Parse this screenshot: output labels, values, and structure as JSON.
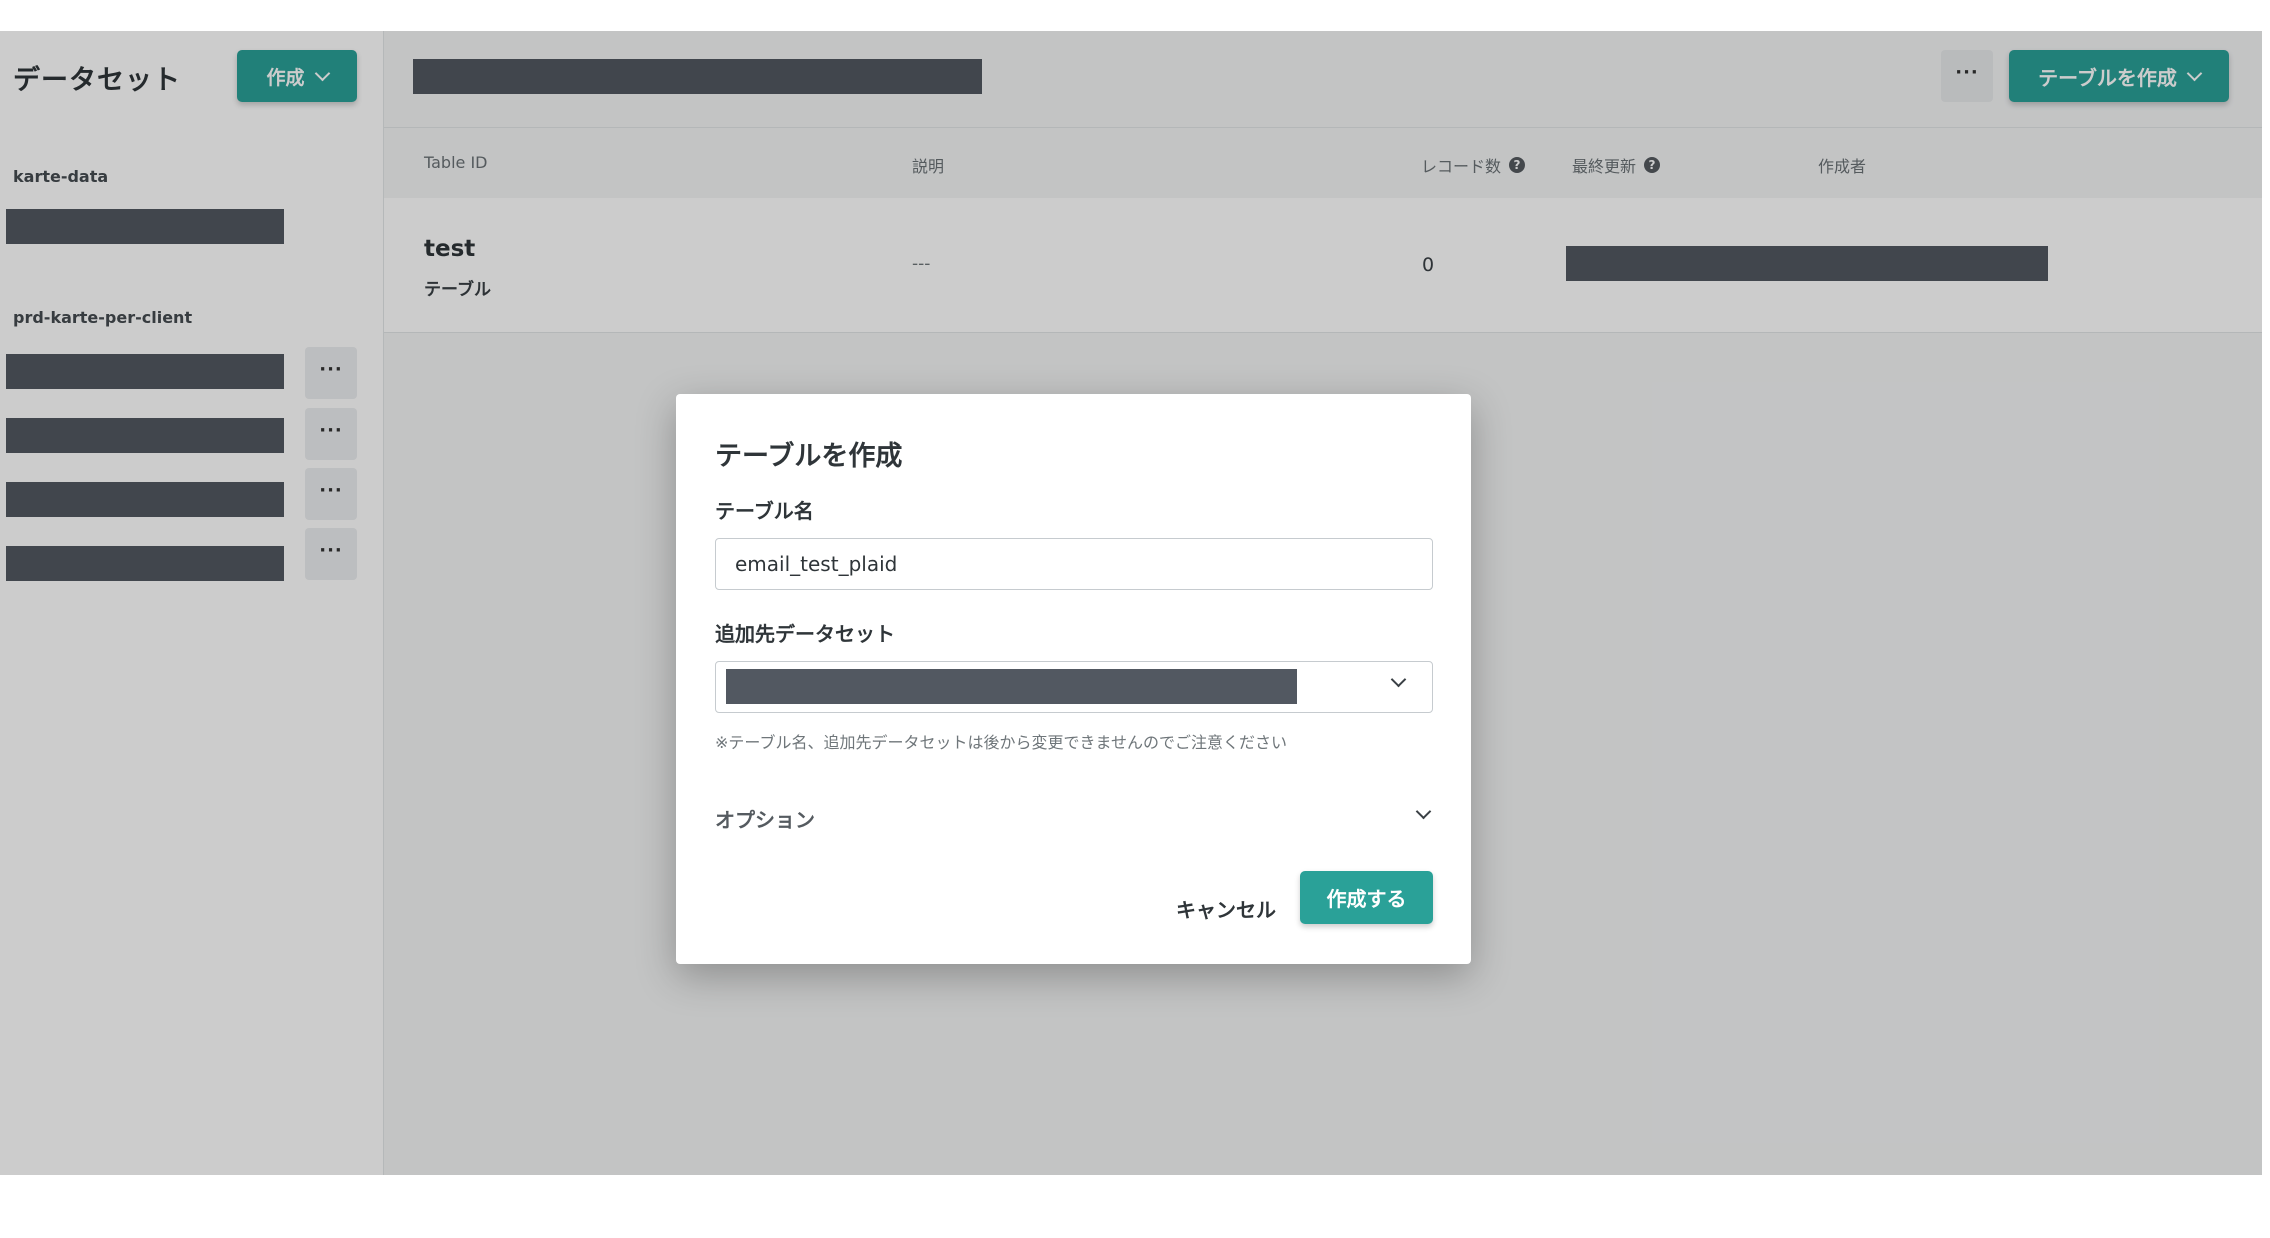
{
  "sidebar": {
    "title": "データセット",
    "create_label": "作成",
    "groups": [
      {
        "label": "karte-data"
      },
      {
        "label": "prd-karte-per-client"
      }
    ],
    "more_label": "···"
  },
  "main": {
    "more_label": "···",
    "create_table_label": "テーブルを作成",
    "columns": {
      "table_id": "Table ID",
      "description": "説明",
      "records": "レコード数",
      "last_updated": "最終更新",
      "creator": "作成者"
    },
    "help_icon": "question-circle-icon",
    "rows": [
      {
        "id": "test",
        "type": "テーブル",
        "description": "---",
        "records": "0"
      }
    ]
  },
  "modal": {
    "title": "テーブルを作成",
    "table_name_label": "テーブル名",
    "table_name_value": "email_test_plaid",
    "dataset_label": "追加先データセット",
    "note": "※テーブル名、追加先データセットは後から変更できませんのでご注意ください",
    "options_label": "オプション",
    "cancel_label": "キャンセル",
    "submit_label": "作成する"
  },
  "colors": {
    "accent": "#2aa198",
    "redaction": "#525861"
  }
}
